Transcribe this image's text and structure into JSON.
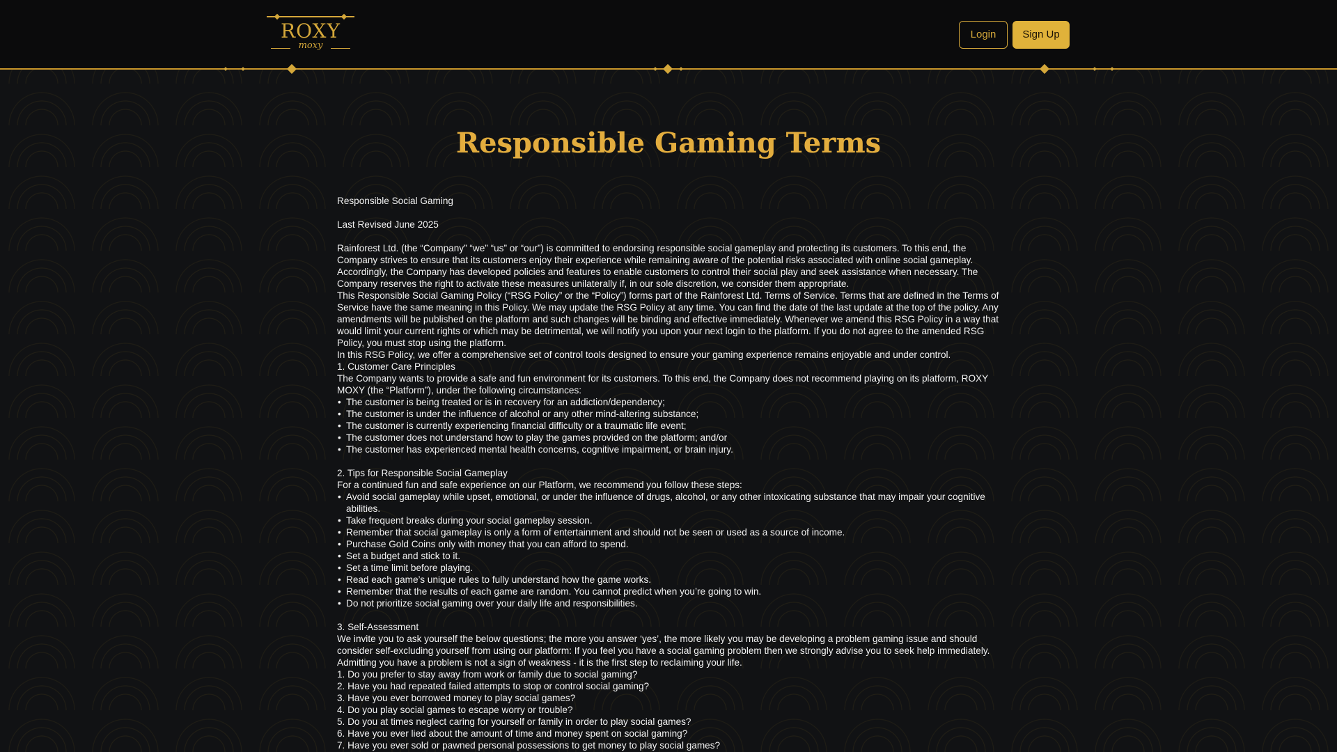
{
  "header": {
    "logo": {
      "brand": "ROXY",
      "sub": "moxy"
    },
    "login_label": "Login",
    "signup_label": "Sign Up",
    "colors": {
      "gold": "#d4a73a",
      "button_fill": "#e0b23a",
      "header_bg": "#0b0b0c"
    }
  },
  "page": {
    "title": "Responsible Gaming Terms"
  },
  "terms": {
    "heading": "Responsible Social Gaming",
    "revised": "Last Revised June 2025",
    "intro_1": "Rainforest Ltd. (the “Company” “we” “us” or “our”) is committed to endorsing responsible social gameplay and protecting its customers. To this end, the Company strives to ensure that its customers enjoy their experience while remaining aware of the potential risks associated with online social gameplay. Accordingly, the Company has developed policies and features to enable customers to control their social play and seek assistance when necessary. The Company reserves the right to activate these measures unilaterally if, in our sole discretion, we consider them appropriate.",
    "intro_2": "This Responsible Social Gaming Policy (“RSG Policy” or the “Policy”) forms part of the Rainforest Ltd. Terms of Service. Terms that are defined in the Terms of Service have the same meaning in this Policy.  We may update the RSG Policy at any time. You can find the date of the last update at the top of the policy. Any amendments will be published on the platform and such changes will be binding and effective immediately. Whenever we amend this RSG Policy in a way that would limit your current rights or which may be detrimental, we will notify you upon your next login to the platform. If you do not agree to the amended RSG Policy, you must stop using the platform.",
    "intro_3": "In this RSG Policy, we offer a comprehensive set of control tools designed to ensure your gaming experience remains enjoyable and under control.",
    "section1": {
      "title": "1. Customer Care Principles",
      "text": "The Company wants to provide a safe and fun environment for its customers. To this end, the Company does not recommend playing on its platform, ROXY MOXY (the “Platform”), under the following circumstances:",
      "items": [
        "The customer is being treated or is in recovery for an addiction/dependency;",
        "The customer is under the influence of alcohol or any other mind-altering substance;",
        "The customer is currently experiencing financial difficulty or a traumatic life event;",
        "The customer does not understand how to play the games provided on the platform; and/or",
        "The customer has experienced mental health concerns, cognitive impairment, or brain injury."
      ]
    },
    "section2": {
      "title": "2. Tips for Responsible Social Gameplay",
      "text": "For a continued fun and safe experience on our Platform, we recommend you follow these steps:",
      "items": [
        "Avoid social gameplay while upset, emotional, or under the influence of drugs, alcohol, or any other intoxicating substance that may impair your cognitive abilities.",
        "Take frequent breaks during your social gameplay session.",
        "Remember that social gameplay is only a form of entertainment and should not be seen or used as a source of income.",
        "Purchase Gold Coins only with money that you can afford to spend.",
        "Set a budget and stick to it.",
        "Set a time limit before playing.",
        "Read each game’s unique rules to fully understand how the game works.",
        "Remember that the results of each game are random. You cannot predict when you’re going to win.",
        "Do not prioritize social gaming over your daily life and responsibilities."
      ]
    },
    "section3": {
      "title": "3. Self-Assessment",
      "text": "We invite you to ask yourself the below questions; the more you answer ‘yes’, the more likely you may be developing a problem gaming issue and should consider self-excluding yourself from using our platform: If you feel you have a social gaming problem then we strongly advise you to seek help immediately. Admitting you have a problem is not a sign of weakness - it is the first step to reclaiming your life.",
      "questions": [
        "1. Do you prefer to stay away from work or family due to social gaming?",
        "2. Have you had repeated failed attempts to stop or control social gaming?",
        "3. Have you ever borrowed money to play social games?",
        "4. Do you play social games to escape worry or trouble?",
        "5. Do you at times neglect caring for yourself or family in order to play social games?",
        "6. Have you ever lied about the amount of time and money spent on social gaming?",
        "7. Have you ever sold or pawned personal possessions to get money to play social games?"
      ]
    }
  }
}
